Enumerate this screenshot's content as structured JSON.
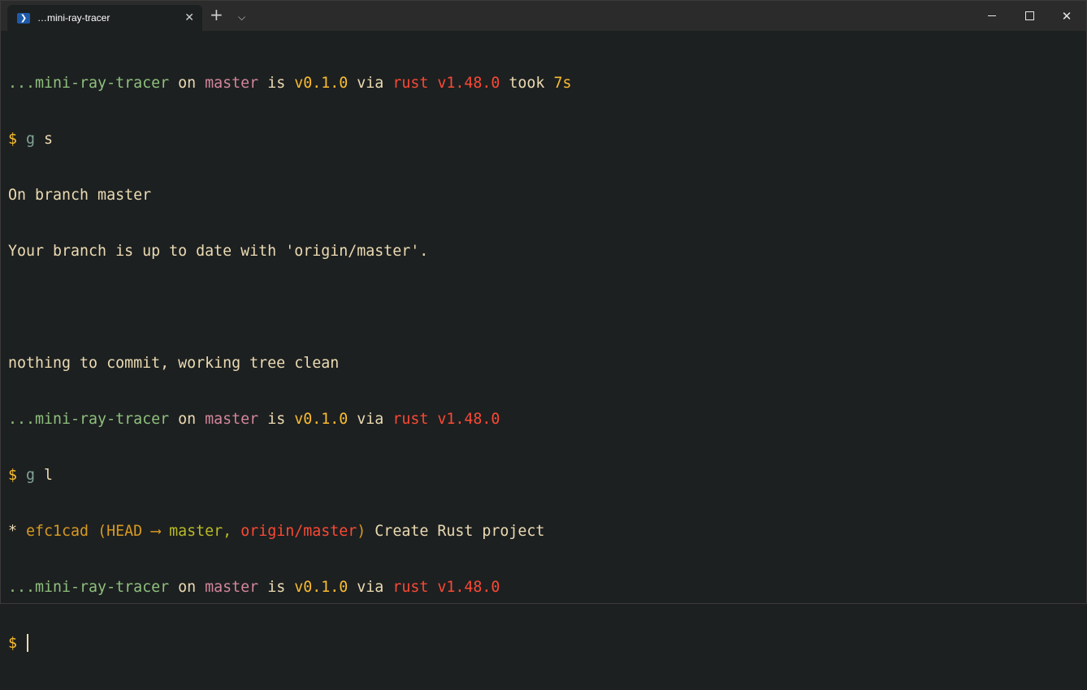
{
  "window": {
    "tab_title": "…mini-ray-tracer",
    "tab_icon": "powershell-icon",
    "new_tab": "+",
    "dropdown": "⌵",
    "close_tab": "✕",
    "close": "✕"
  },
  "terminal": {
    "p1": {
      "dir": "...mini-ray-tracer",
      "on": " on ",
      "branch": "master",
      "is": " is ",
      "version": "v0.1.0",
      "via": " via ",
      "rust": "rust v1.48.0",
      "took": " took ",
      "time": "7s"
    },
    "cmd1": {
      "dollar": "$ ",
      "cmd": "g",
      "arg": " s"
    },
    "out1": "On branch master",
    "out2": "Your branch is up to date with 'origin/master'.",
    "out3": "",
    "out4": "nothing to commit, working tree clean",
    "p2": {
      "dir": "...mini-ray-tracer",
      "on": " on ",
      "branch": "master",
      "is": " is ",
      "version": "v0.1.0",
      "via": " via ",
      "rust": "rust v1.48.0"
    },
    "cmd2": {
      "dollar": "$ ",
      "cmd": "g",
      "arg": " l"
    },
    "log": {
      "star": "* ",
      "hash": "efc1cad",
      "open": " (HEAD ⟶ ",
      "master": "master,",
      "space": " ",
      "origin": "origin/master",
      "close": ")",
      "msg": " Create Rust project"
    },
    "p3": {
      "dir": "...mini-ray-tracer",
      "on": " on ",
      "branch": "master",
      "is": " is ",
      "version": "v0.1.0",
      "via": " via ",
      "rust": "rust v1.48.0"
    },
    "cmd3": {
      "dollar": "$ "
    }
  }
}
